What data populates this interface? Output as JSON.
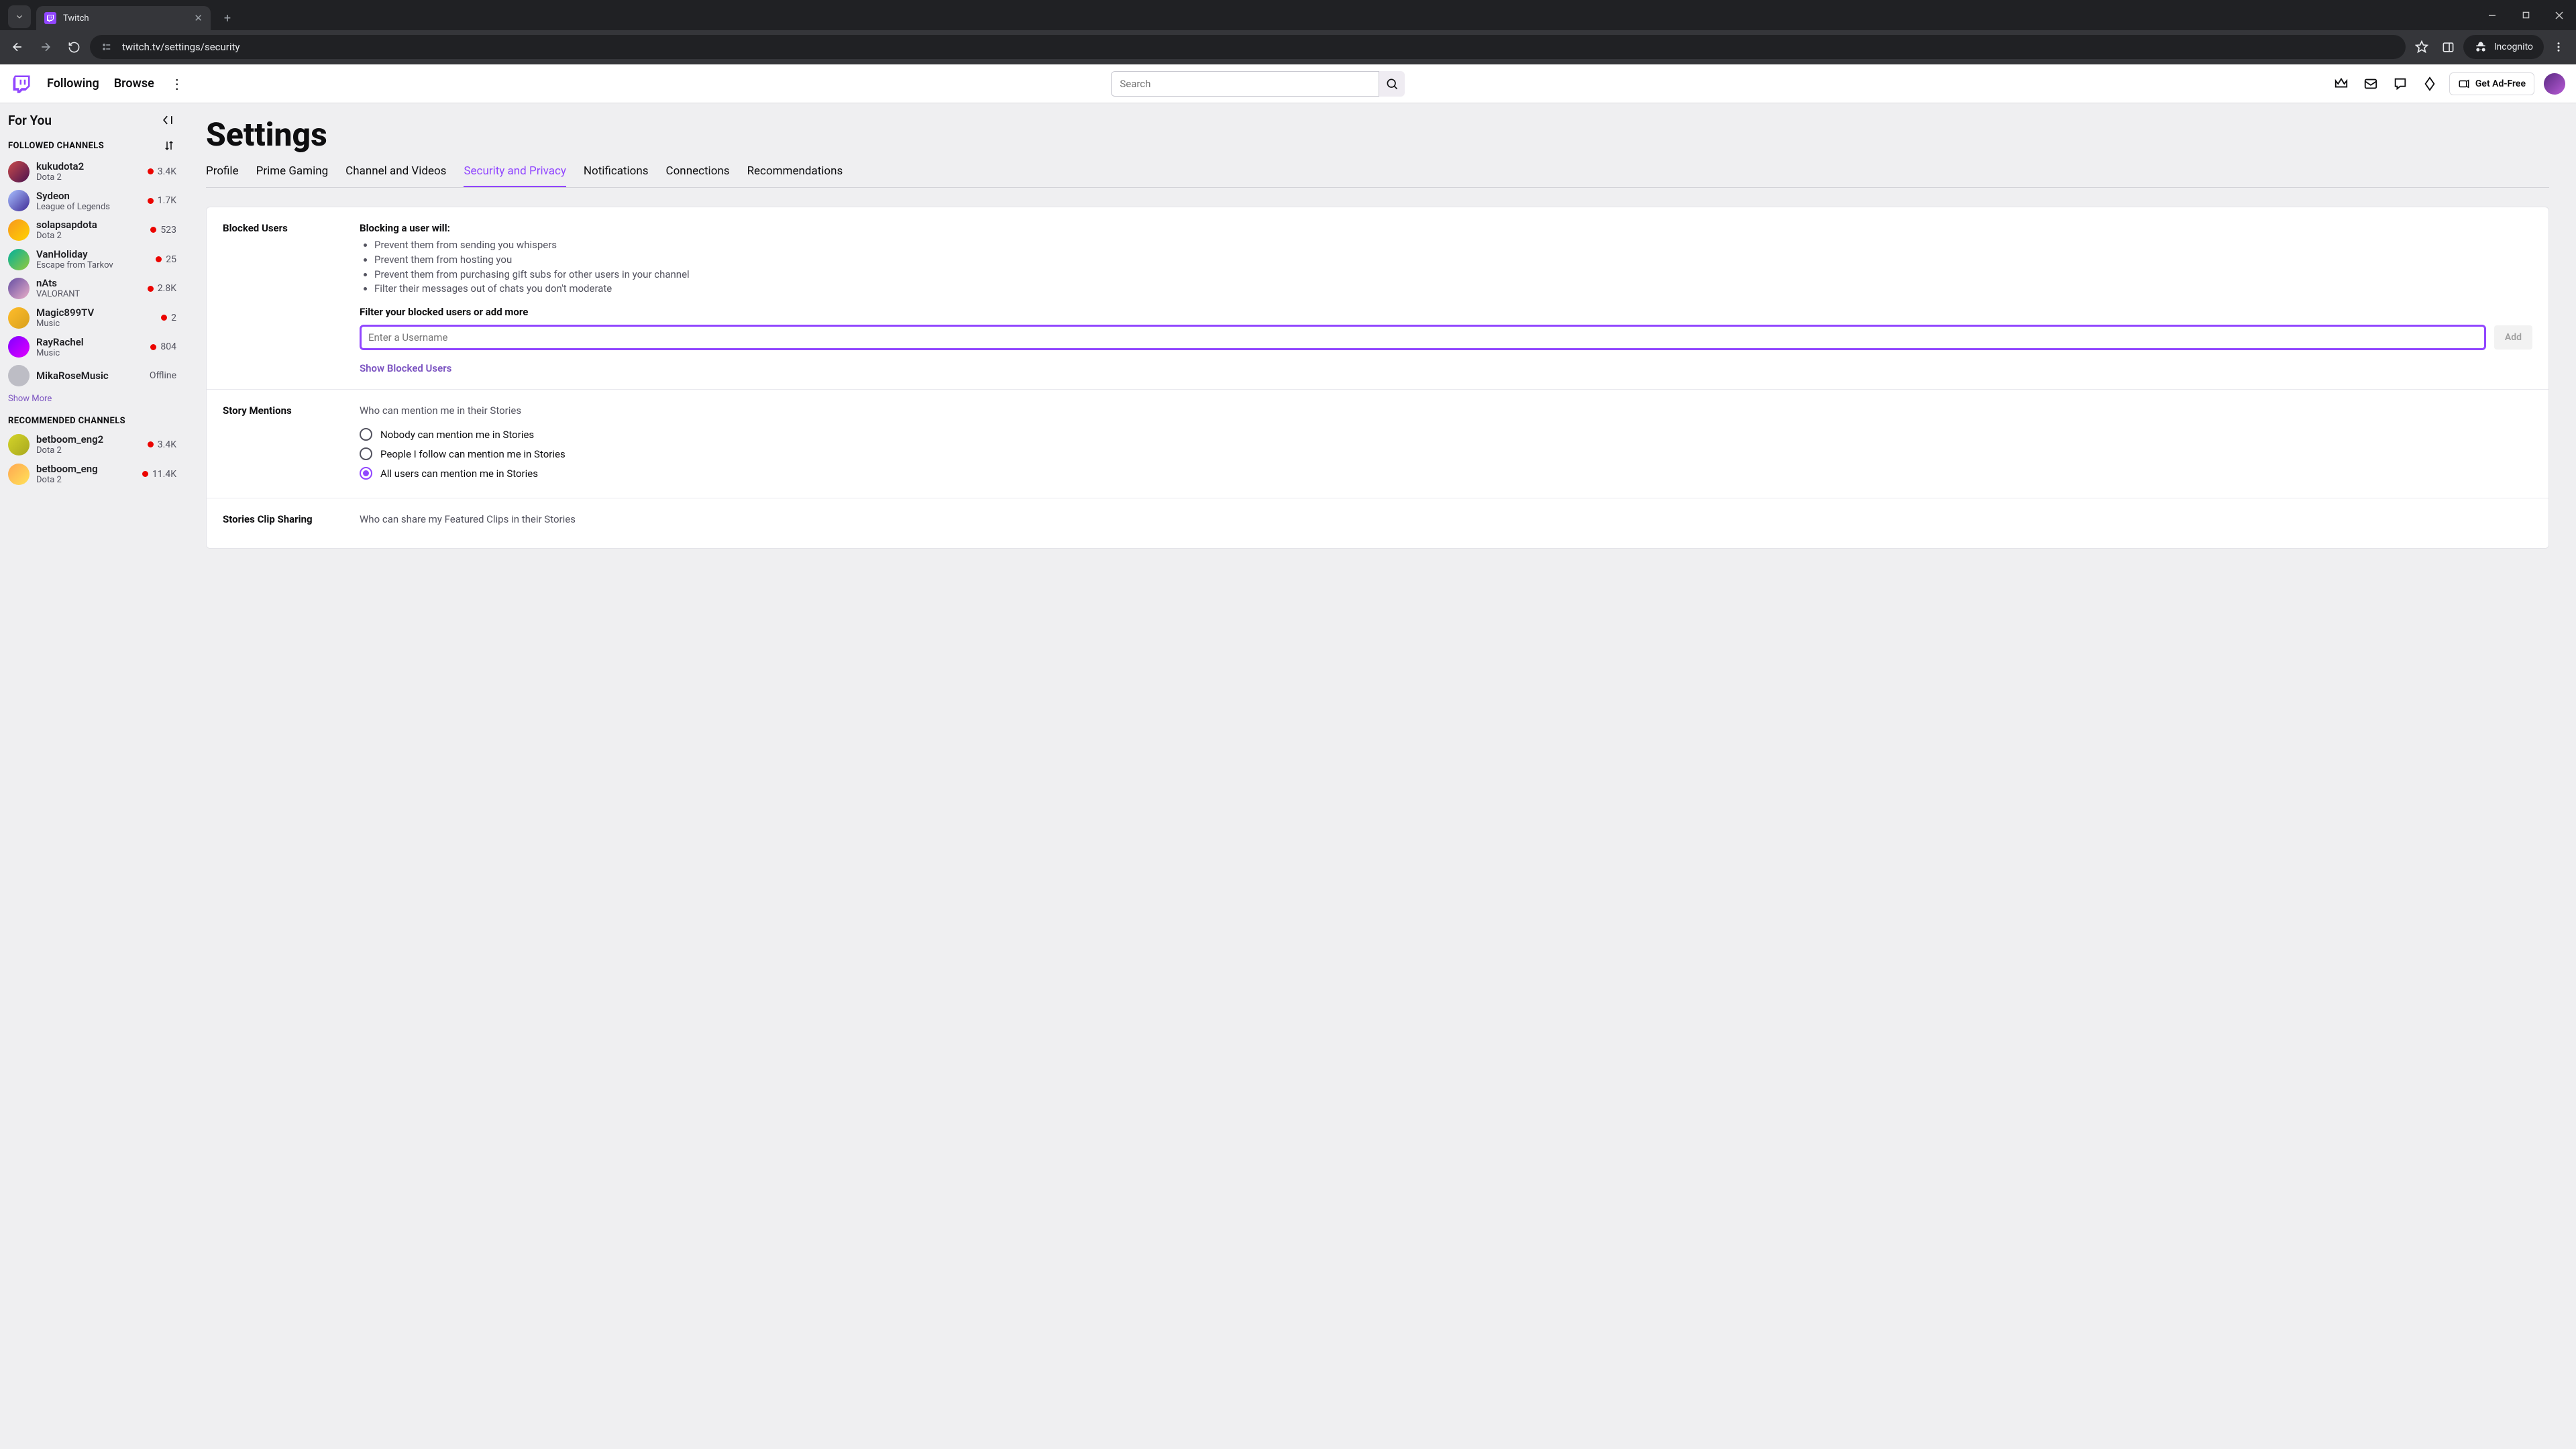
{
  "browser": {
    "tab_title": "Twitch",
    "url": "twitch.tv/settings/security",
    "incognito_label": "Incognito"
  },
  "topnav": {
    "following": "Following",
    "browse": "Browse",
    "search_placeholder": "Search",
    "get_ad_free": "Get Ad-Free"
  },
  "sidebar": {
    "title": "For You",
    "followed_header": "FOLLOWED CHANNELS",
    "recommended_header": "RECOMMENDED CHANNELS",
    "show_more": "Show More",
    "offline_label": "Offline",
    "followed": [
      {
        "name": "kukudota2",
        "game": "Dota 2",
        "viewers": "3.4K",
        "live": true,
        "g": "g1"
      },
      {
        "name": "Sydeon",
        "game": "League of Legends",
        "viewers": "1.7K",
        "live": true,
        "g": "g2"
      },
      {
        "name": "solapsapdota",
        "game": "Dota 2",
        "viewers": "523",
        "live": true,
        "g": "g3"
      },
      {
        "name": "VanHoliday",
        "game": "Escape from Tarkov",
        "viewers": "25",
        "live": true,
        "g": "g4"
      },
      {
        "name": "nAts",
        "game": "VALORANT",
        "viewers": "2.8K",
        "live": true,
        "g": "g5"
      },
      {
        "name": "Magic899TV",
        "game": "Music",
        "viewers": "2",
        "live": true,
        "g": "g6"
      },
      {
        "name": "RayRachel",
        "game": "Music",
        "viewers": "804",
        "live": true,
        "g": "g7"
      },
      {
        "name": "MikaRoseMusic",
        "game": "",
        "viewers": "",
        "live": false,
        "g": "g8"
      }
    ],
    "recommended": [
      {
        "name": "betboom_eng2",
        "game": "Dota 2",
        "viewers": "3.4K",
        "live": true,
        "g": "g9"
      },
      {
        "name": "betboom_eng",
        "game": "Dota 2",
        "viewers": "11.4K",
        "live": true,
        "g": "g10"
      }
    ]
  },
  "settings": {
    "heading": "Settings",
    "tabs": [
      "Profile",
      "Prime Gaming",
      "Channel and Videos",
      "Security and Privacy",
      "Notifications",
      "Connections",
      "Recommendations"
    ],
    "active_tab": 3,
    "blocked": {
      "label": "Blocked Users",
      "subhead": "Blocking a user will:",
      "effects": [
        "Prevent them from sending you whispers",
        "Prevent them from hosting you",
        "Prevent them from purchasing gift subs for other users in your channel",
        "Filter their messages out of chats you don't moderate"
      ],
      "filter_label": "Filter your blocked users or add more",
      "placeholder": "Enter a Username",
      "add_label": "Add",
      "show_blocked": "Show Blocked Users"
    },
    "story_mentions": {
      "label": "Story Mentions",
      "question": "Who can mention me in their Stories",
      "options": [
        "Nobody can mention me in Stories",
        "People I follow can mention me in Stories",
        "All users can mention me in Stories"
      ],
      "selected": 2
    },
    "clip_sharing": {
      "label": "Stories Clip Sharing",
      "question": "Who can share my Featured Clips in their Stories"
    }
  }
}
